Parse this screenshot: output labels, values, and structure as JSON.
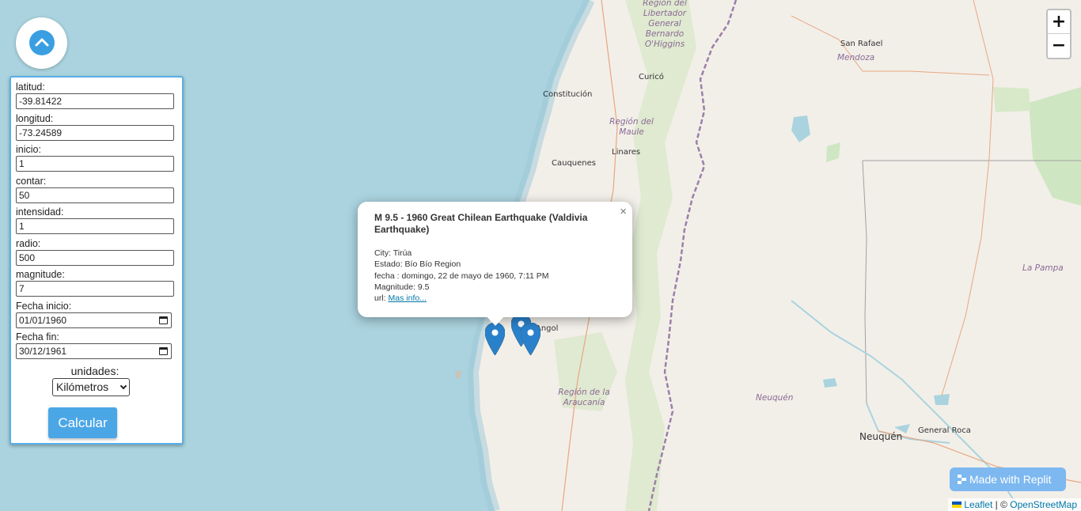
{
  "map": {
    "zoom_in_label": "+",
    "zoom_out_label": "−",
    "labels": {
      "region_ohiggins": "Región del Libertador General Bernardo O'Higgins",
      "region_maule": "Región del Maule",
      "region_araucania": "Región de la Araucanía",
      "san_rafael": "San Rafael",
      "mendoza": "Mendoza",
      "curico": "Curicó",
      "constitucion": "Constitución",
      "linares": "Linares",
      "cauquenes": "Cauquenes",
      "angol": "Angol",
      "la_pampa": "La Pampa",
      "neuquen_prov": "Neuquén",
      "neuquen_city": "Neuquén",
      "general_roca": "General Roca"
    }
  },
  "form": {
    "fields": [
      {
        "label": "latitud:",
        "value": "-39.81422"
      },
      {
        "label": "longitud:",
        "value": "-73.24589"
      },
      {
        "label": "inicio:",
        "value": "1"
      },
      {
        "label": "contar:",
        "value": "50"
      },
      {
        "label": "intensidad:",
        "value": "1"
      },
      {
        "label": "radio:",
        "value": "500"
      },
      {
        "label": "magnitude:",
        "value": "7"
      },
      {
        "label": "Fecha inicio:",
        "value": "01/01/1960"
      },
      {
        "label": "Fecha fin:",
        "value": "30/12/1961"
      }
    ],
    "units_label": "unidades:",
    "units_value": "Kilómetros",
    "submit_label": "Calcular"
  },
  "popup": {
    "title": "M 9.5 - 1960 Great Chilean Earthquake (Valdivia Earthquake)",
    "city": "City: Tirúa",
    "estado": "Estado: Bío Bío Region",
    "fecha": "fecha : domingo, 22 de mayo de 1960, 7:11 PM",
    "magnitude": "Magnitude: 9.5",
    "url_prefix": "url:",
    "url_link": "Mas info...",
    "close_label": "×"
  },
  "replit_badge": "Made with Replit",
  "attribution": {
    "leaflet": "Leaflet",
    "separator": "| ©",
    "osm": "OpenStreetMap"
  },
  "colors": {
    "sea": "#aad3df",
    "land": "#f2efe9",
    "accent": "#3a9fe2",
    "marker": "#2a81cb"
  }
}
